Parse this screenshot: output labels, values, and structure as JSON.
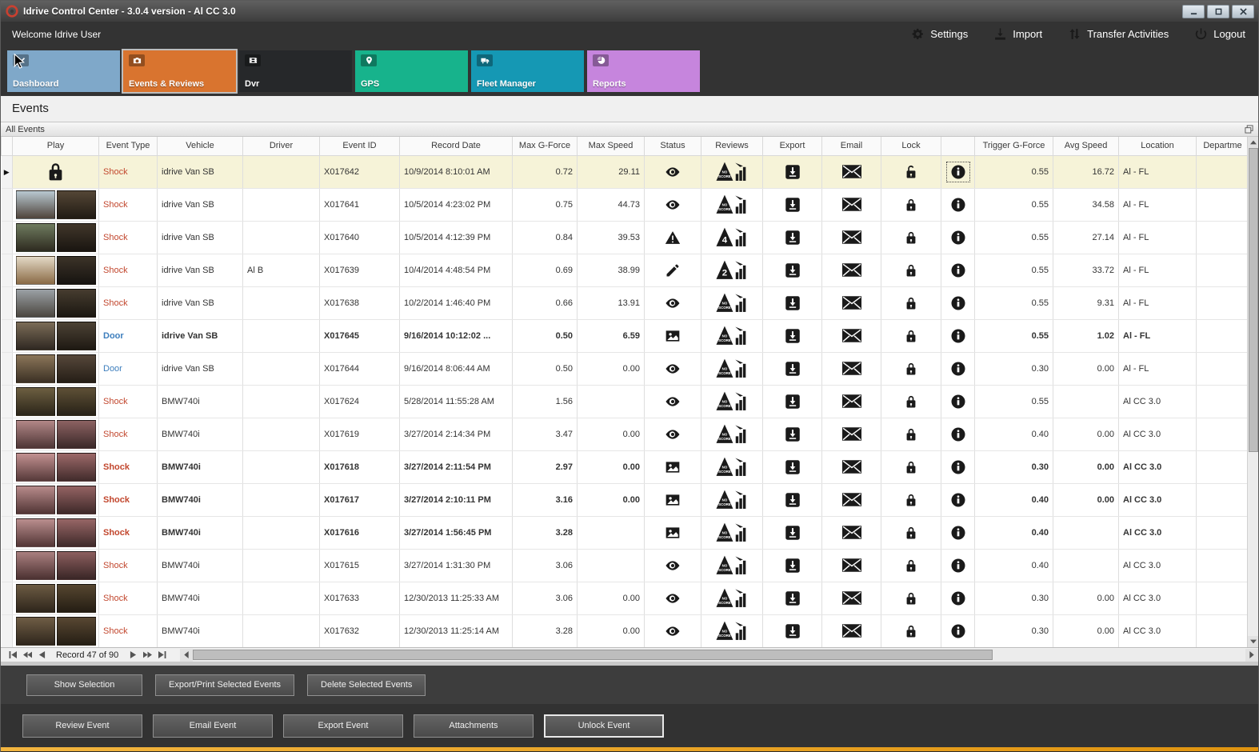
{
  "window": {
    "title": "Idrive Control Center - 3.0.4 version - Al CC 3.0"
  },
  "header": {
    "welcome": "Welcome Idrive User",
    "actions": [
      {
        "id": "settings",
        "label": "Settings",
        "icon": "gear"
      },
      {
        "id": "import",
        "label": "Import",
        "icon": "import"
      },
      {
        "id": "transfer-activities",
        "label": "Transfer Activities",
        "icon": "transfer"
      },
      {
        "id": "logout",
        "label": "Logout",
        "icon": "power"
      }
    ]
  },
  "nav_tiles": [
    {
      "id": "dashboard",
      "label": "Dashboard",
      "color": "#7fa8c9",
      "icon": "check",
      "selected": false
    },
    {
      "id": "events-reviews",
      "label": "Events & Reviews",
      "color": "#d9742f",
      "icon": "camera",
      "selected": true
    },
    {
      "id": "dvr",
      "label": "Dvr",
      "color": "#26282a",
      "icon": "film",
      "selected": false
    },
    {
      "id": "gps",
      "label": "GPS",
      "color": "#17b38c",
      "icon": "pin",
      "selected": false
    },
    {
      "id": "fleet-manager",
      "label": "Fleet Manager",
      "color": "#1598b4",
      "icon": "fleet",
      "selected": false
    },
    {
      "id": "reports",
      "label": "Reports",
      "color": "#c685dd",
      "icon": "pie",
      "selected": false
    }
  ],
  "page": {
    "title": "Events",
    "panel_title": "All Events"
  },
  "theme": {
    "accent_stripe_left": "#f2b53f",
    "accent_stripe_right": "#e0940f",
    "selected_row": "#f6f3d8",
    "shock_color": "#c2472e",
    "door_color": "#3d7ebd"
  },
  "table": {
    "columns": [
      "",
      "Play",
      "Event Type",
      "Vehicle",
      "Driver",
      "Event ID",
      "Record Date",
      "Max G-Force",
      "Max Speed",
      "Status",
      "Reviews",
      "Export",
      "Email",
      "Lock",
      "",
      "Trigger G-Force",
      "Avg Speed",
      "Location",
      "Departme"
    ],
    "rows": [
      {
        "selected": true,
        "bold": false,
        "play": "lock",
        "thumb": null,
        "event_type": "Shock",
        "vehicle": "idrive Van SB",
        "driver": "",
        "event_id": "X017642",
        "record_date": "10/9/2014 8:10:01 AM",
        "max_g_force": "0.72",
        "max_speed": "29.11",
        "status": "eye",
        "review": "no-score",
        "lock": "unlocked",
        "info_focused": true,
        "trigger_g_force": "0.55",
        "avg_speed": "16.72",
        "location": "Al - FL",
        "department": ""
      },
      {
        "selected": false,
        "bold": false,
        "play": "thumb",
        "thumb": [
          [
            "#b9c9d2",
            "#4e433a"
          ],
          [
            "#544636",
            "#211b14"
          ]
        ],
        "event_type": "Shock",
        "vehicle": "idrive Van SB",
        "driver": "",
        "event_id": "X017641",
        "record_date": "10/5/2014 4:23:02 PM",
        "max_g_force": "0.75",
        "max_speed": "44.73",
        "status": "eye",
        "review": "no-score",
        "lock": "locked",
        "info_focused": false,
        "trigger_g_force": "0.55",
        "avg_speed": "34.58",
        "location": "Al - FL",
        "department": ""
      },
      {
        "selected": false,
        "bold": false,
        "play": "thumb",
        "thumb": [
          [
            "#6f7b5f",
            "#2d2a1f"
          ],
          [
            "#41372a",
            "#191510"
          ]
        ],
        "event_type": "Shock",
        "vehicle": "idrive Van SB",
        "driver": "",
        "event_id": "X017640",
        "record_date": "10/5/2014 4:12:39 PM",
        "max_g_force": "0.84",
        "max_speed": "39.53",
        "status": "warning",
        "review": "4",
        "lock": "locked",
        "info_focused": false,
        "trigger_g_force": "0.55",
        "avg_speed": "27.14",
        "location": "Al - FL",
        "department": ""
      },
      {
        "selected": false,
        "bold": false,
        "play": "thumb",
        "thumb": [
          [
            "#e3d9c6",
            "#8a6a45"
          ],
          [
            "#3c3328",
            "#161310"
          ]
        ],
        "event_type": "Shock",
        "vehicle": "idrive Van SB",
        "driver": "Al B",
        "event_id": "X017639",
        "record_date": "10/4/2014 4:48:54 PM",
        "max_g_force": "0.69",
        "max_speed": "38.99",
        "status": "pencil",
        "review": "2",
        "lock": "locked",
        "info_focused": false,
        "trigger_g_force": "0.55",
        "avg_speed": "33.72",
        "location": "Al - FL",
        "department": ""
      },
      {
        "selected": false,
        "bold": false,
        "play": "thumb",
        "thumb": [
          [
            "#9ba1a5",
            "#4b463f"
          ],
          [
            "#463c2f",
            "#1b1711"
          ]
        ],
        "event_type": "Shock",
        "vehicle": "idrive Van SB",
        "driver": "",
        "event_id": "X017638",
        "record_date": "10/2/2014 1:46:40 PM",
        "max_g_force": "0.66",
        "max_speed": "13.91",
        "status": "eye",
        "review": "no-score",
        "lock": "locked",
        "info_focused": false,
        "trigger_g_force": "0.55",
        "avg_speed": "9.31",
        "location": "Al - FL",
        "department": ""
      },
      {
        "selected": false,
        "bold": true,
        "play": "thumb",
        "thumb": [
          [
            "#7b6c57",
            "#2f2822"
          ],
          [
            "#4c4234",
            "#1e1913"
          ]
        ],
        "event_type": "Door",
        "vehicle": "idrive Van SB",
        "driver": "",
        "event_id": "X017645",
        "record_date": "9/16/2014 10:12:02 ...",
        "max_g_force": "0.50",
        "max_speed": "6.59",
        "status": "image",
        "review": "no-score",
        "lock": "locked",
        "info_focused": false,
        "trigger_g_force": "0.55",
        "avg_speed": "1.02",
        "location": "Al - FL",
        "department": ""
      },
      {
        "selected": false,
        "bold": false,
        "play": "thumb",
        "thumb": [
          [
            "#8b7659",
            "#3b3024"
          ],
          [
            "#56473a",
            "#251e16"
          ]
        ],
        "event_type": "Door",
        "vehicle": "idrive Van SB",
        "driver": "",
        "event_id": "X017644",
        "record_date": "9/16/2014 8:06:44 AM",
        "max_g_force": "0.50",
        "max_speed": "0.00",
        "status": "eye",
        "review": "no-score",
        "lock": "locked",
        "info_focused": false,
        "trigger_g_force": "0.30",
        "avg_speed": "0.00",
        "location": "Al - FL",
        "department": ""
      },
      {
        "selected": false,
        "bold": false,
        "play": "thumb",
        "thumb": [
          [
            "#6d5f41",
            "#2b2519"
          ],
          [
            "#5e5036",
            "#272117"
          ]
        ],
        "event_type": "Shock",
        "vehicle": "BMW740i",
        "driver": "",
        "event_id": "X017624",
        "record_date": "5/28/2014 11:55:28 AM",
        "max_g_force": "1.56",
        "max_speed": "",
        "status": "eye",
        "review": "no-score",
        "lock": "locked",
        "info_focused": false,
        "trigger_g_force": "0.55",
        "avg_speed": "",
        "location": "Al CC 3.0",
        "department": ""
      },
      {
        "selected": false,
        "bold": false,
        "play": "thumb",
        "thumb": [
          [
            "#b28787",
            "#4e3636"
          ],
          [
            "#8c6262",
            "#3b2929"
          ]
        ],
        "event_type": "Shock",
        "vehicle": "BMW740i",
        "driver": "",
        "event_id": "X017619",
        "record_date": "3/27/2014 2:14:34 PM",
        "max_g_force": "3.47",
        "max_speed": "0.00",
        "status": "eye",
        "review": "no-score",
        "lock": "locked",
        "info_focused": false,
        "trigger_g_force": "0.40",
        "avg_speed": "0.00",
        "location": "Al CC 3.0",
        "department": ""
      },
      {
        "selected": false,
        "bold": true,
        "play": "thumb",
        "thumb": [
          [
            "#c29191",
            "#563939"
          ],
          [
            "#9c6969",
            "#412b2b"
          ]
        ],
        "event_type": "Shock",
        "vehicle": "BMW740i",
        "driver": "",
        "event_id": "X017618",
        "record_date": "3/27/2014 2:11:54 PM",
        "max_g_force": "2.97",
        "max_speed": "0.00",
        "status": "image",
        "review": "no-score",
        "lock": "locked",
        "info_focused": false,
        "trigger_g_force": "0.30",
        "avg_speed": "0.00",
        "location": "Al CC 3.0",
        "department": ""
      },
      {
        "selected": false,
        "bold": true,
        "play": "thumb",
        "thumb": [
          [
            "#b78b8b",
            "#523535"
          ],
          [
            "#946363",
            "#3e2929"
          ]
        ],
        "event_type": "Shock",
        "vehicle": "BMW740i",
        "driver": "",
        "event_id": "X017617",
        "record_date": "3/27/2014 2:10:11 PM",
        "max_g_force": "3.16",
        "max_speed": "0.00",
        "status": "image",
        "review": "no-score",
        "lock": "locked",
        "info_focused": false,
        "trigger_g_force": "0.40",
        "avg_speed": "0.00",
        "location": "Al CC 3.0",
        "department": ""
      },
      {
        "selected": false,
        "bold": true,
        "play": "thumb",
        "thumb": [
          [
            "#ba8e8e",
            "#533636"
          ],
          [
            "#976666",
            "#3f2a2a"
          ]
        ],
        "event_type": "Shock",
        "vehicle": "BMW740i",
        "driver": "",
        "event_id": "X017616",
        "record_date": "3/27/2014 1:56:45 PM",
        "max_g_force": "3.28",
        "max_speed": "",
        "status": "image",
        "review": "no-score",
        "lock": "locked",
        "info_focused": false,
        "trigger_g_force": "0.40",
        "avg_speed": "",
        "location": "Al CC 3.0",
        "department": ""
      },
      {
        "selected": false,
        "bold": false,
        "play": "thumb",
        "thumb": [
          [
            "#aa8080",
            "#4b3131"
          ],
          [
            "#8c5e5e",
            "#392626"
          ]
        ],
        "event_type": "Shock",
        "vehicle": "BMW740i",
        "driver": "",
        "event_id": "X017615",
        "record_date": "3/27/2014 1:31:30 PM",
        "max_g_force": "3.06",
        "max_speed": "",
        "status": "eye",
        "review": "no-score",
        "lock": "locked",
        "info_focused": false,
        "trigger_g_force": "0.40",
        "avg_speed": "",
        "location": "Al CC 3.0",
        "department": ""
      },
      {
        "selected": false,
        "bold": false,
        "play": "thumb",
        "thumb": [
          [
            "#6c5b43",
            "#2e251b"
          ],
          [
            "#564630",
            "#241d13"
          ]
        ],
        "event_type": "Shock",
        "vehicle": "BMW740i",
        "driver": "",
        "event_id": "X017633",
        "record_date": "12/30/2013 11:25:33 AM",
        "max_g_force": "3.06",
        "max_speed": "0.00",
        "status": "eye",
        "review": "no-score",
        "lock": "locked",
        "info_focused": false,
        "trigger_g_force": "0.30",
        "avg_speed": "0.00",
        "location": "Al CC 3.0",
        "department": ""
      },
      {
        "selected": false,
        "bold": false,
        "play": "thumb",
        "thumb": [
          [
            "#6f5d45",
            "#2f261c"
          ],
          [
            "#584732",
            "#251e14"
          ]
        ],
        "event_type": "Shock",
        "vehicle": "BMW740i",
        "driver": "",
        "event_id": "X017632",
        "record_date": "12/30/2013 11:25:14 AM",
        "max_g_force": "3.28",
        "max_speed": "0.00",
        "status": "eye",
        "review": "no-score",
        "lock": "locked",
        "info_focused": false,
        "trigger_g_force": "0.30",
        "avg_speed": "0.00",
        "location": "Al CC 3.0",
        "department": ""
      }
    ]
  },
  "pager": {
    "record_label": "Record 47 of 90"
  },
  "selection_bar": {
    "buttons": [
      "Show Selection",
      "Export/Print Selected Events",
      "Delete Selected  Events"
    ]
  },
  "event_bar": {
    "buttons": [
      "Review Event",
      "Email Event",
      "Export Event",
      "Attachments",
      "Unlock Event"
    ],
    "focused": "Unlock Event"
  }
}
